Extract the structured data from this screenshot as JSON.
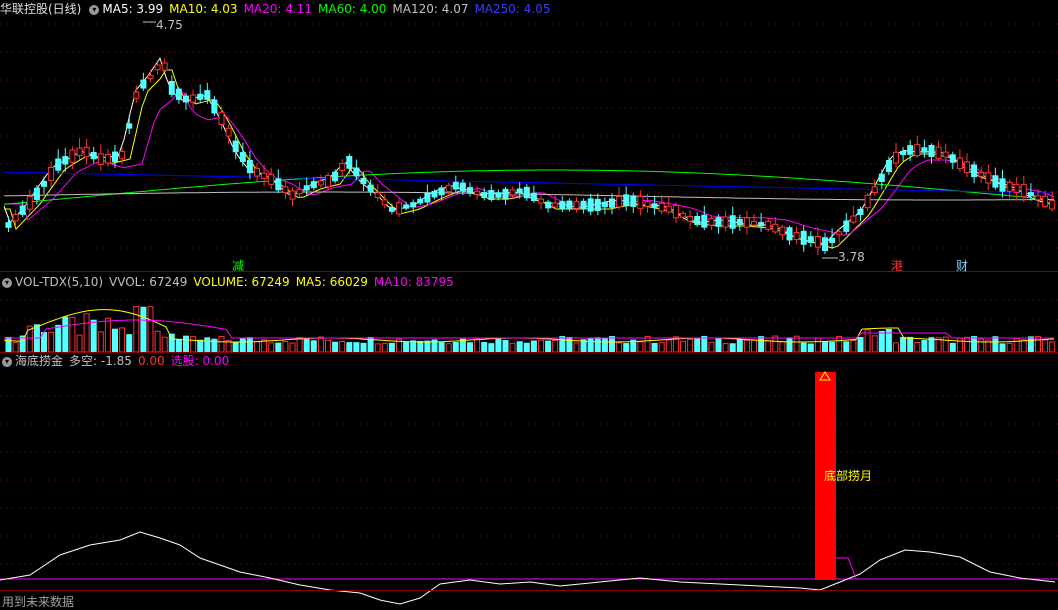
{
  "header1": {
    "stock_title": "华联控股(日线)",
    "ma5": "MA5: 3.99",
    "ma10": "MA10: 4.03",
    "ma20": "MA20: 4.11",
    "ma60": "MA60: 4.00",
    "ma120": "MA120: 4.07",
    "ma250": "MA250: 4.05"
  },
  "header2": {
    "indicator": "VOL-TDX(5,10)",
    "vvol": "VVOL: 67249",
    "volume": "VOLUME: 67249",
    "ma5": "MA5: 66029",
    "ma10": "MA10: 83795"
  },
  "header3": {
    "indicator": "海底捞金",
    "duokong": "多空: -1.85",
    "value": "0.00",
    "xuangu": "选股: 0.00"
  },
  "price_labels": {
    "high": "4.75",
    "low": "3.78"
  },
  "markers": {
    "jian": "减",
    "gang": "港",
    "cai": "财"
  },
  "signal_label": "底部捞月",
  "footer_note": "用到未来数据",
  "colors": {
    "bg": "#000000",
    "up": "#ff3232",
    "down": "#54ffff",
    "ma5": "#ffffff",
    "ma10": "#ffff00",
    "ma20": "#ff00ff",
    "ma60": "#00ff00",
    "ma120": "#c0c0c0",
    "ma250": "#0000ff",
    "signal_bar": "#ff0000"
  }
}
